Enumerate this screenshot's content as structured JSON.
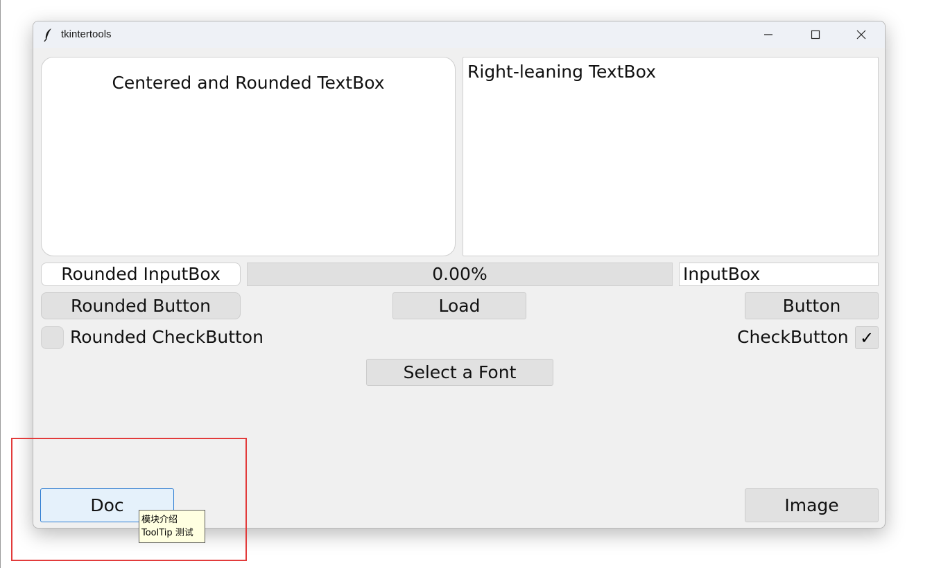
{
  "window": {
    "title": "tkintertools",
    "controls": {
      "minimize_icon": "minimize-icon",
      "maximize_icon": "maximize-icon",
      "close_icon": "close-icon"
    }
  },
  "textboxes": {
    "centered": "Centered and Rounded TextBox",
    "right": "Right-leaning TextBox"
  },
  "inputs": {
    "rounded": "Rounded InputBox",
    "plain": "InputBox"
  },
  "progress": {
    "text": "0.00%",
    "fraction": 0.0
  },
  "buttons": {
    "rounded": "Rounded Button",
    "load": "Load",
    "button": "Button",
    "select_font": "Select a Font",
    "doc": "Doc",
    "image": "Image"
  },
  "checkbuttons": {
    "rounded_label": "Rounded CheckButton",
    "rounded_checked": false,
    "right_label": "CheckButton",
    "right_checked": true,
    "check_glyph": "✓"
  },
  "tooltip": {
    "line1": "模块介绍",
    "line2": "ToolTip 测试"
  },
  "colors": {
    "highlight": "#e23b3b",
    "doc_hover": "#e5f1fb",
    "doc_border": "#2c7cd2",
    "tooltip_bg": "#ffffe1"
  }
}
